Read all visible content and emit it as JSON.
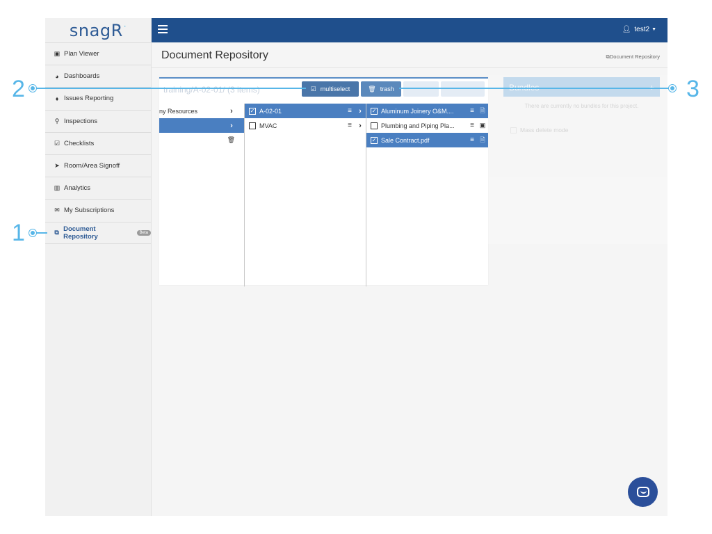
{
  "brand": {
    "name": "snag",
    "accent": "R",
    "dot": "·"
  },
  "sidebar": {
    "items": [
      {
        "label": "Plan Viewer",
        "icon": "image-icon"
      },
      {
        "label": "Dashboards",
        "icon": "dashboard-icon"
      },
      {
        "label": "Issues Reporting",
        "icon": "map-marker-icon"
      },
      {
        "label": "Inspections",
        "icon": "search-icon"
      },
      {
        "label": "Checklists",
        "icon": "checkbox-icon"
      },
      {
        "label": "Room/Area Signoff",
        "icon": "location-arrow-icon"
      },
      {
        "label": "Analytics",
        "icon": "bar-chart-icon"
      },
      {
        "label": "My Subscriptions",
        "icon": "envelope-icon"
      },
      {
        "label": "Document Repository",
        "icon": "copy-icon",
        "badge": "Beta"
      }
    ]
  },
  "topbar": {
    "user": "test2"
  },
  "page": {
    "title": "Document Repository",
    "breadcrumb": "Document Repository"
  },
  "browser": {
    "path": "training/A-02-01/ (3 items)",
    "buttons": {
      "multiselect": "multiselect",
      "trash": "trash"
    },
    "col1": [
      {
        "name": "ny Resources",
        "selected": false
      },
      {
        "name": "",
        "selected": true
      }
    ],
    "col2": [
      {
        "name": "A-02-01",
        "selected": true
      },
      {
        "name": "MVAC",
        "selected": false
      }
    ],
    "col3": [
      {
        "name": "Aluminum Joinery O&M....",
        "selected": true
      },
      {
        "name": "Plumbing and Piping Pla...",
        "selected": false
      },
      {
        "name": "Sale Contract.pdf",
        "selected": true
      }
    ]
  },
  "bundles": {
    "title": "Bundles",
    "empty": "There are currently no bundles for this project.",
    "mass_delete": "Mass delete mode"
  },
  "callouts": [
    "1",
    "2",
    "3"
  ],
  "colors": {
    "topbar": "#1f4f8c",
    "selected_row": "#4a7fc1",
    "callout": "#57b6e8",
    "active_nav": "#2e5b95"
  }
}
